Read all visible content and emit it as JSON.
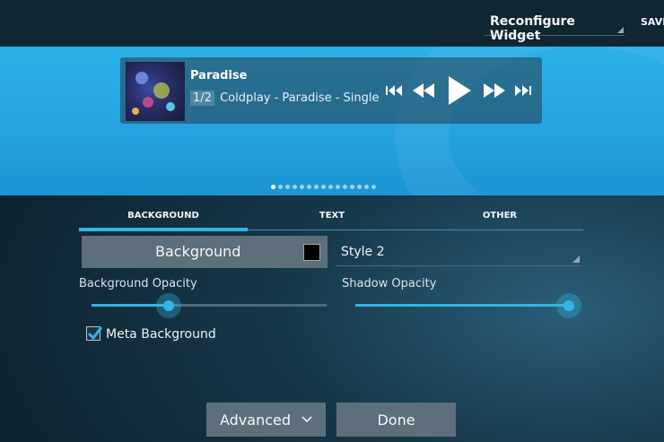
{
  "header": {
    "title": "Reconfigure Widget",
    "save_label": "SAVE"
  },
  "player": {
    "track_title": "Paradise",
    "track_index": "1/2",
    "track_meta": "Coldplay - Paradise - Single",
    "controls": [
      "skip-back-icon",
      "rewind-icon",
      "play-icon",
      "fast-forward-icon",
      "skip-forward-icon"
    ],
    "page_count": 15,
    "current_page": 1
  },
  "tabs": [
    {
      "label": "BACKGROUND",
      "active": true
    },
    {
      "label": "TEXT",
      "active": false
    },
    {
      "label": "OTHER",
      "active": false
    }
  ],
  "background": {
    "button_label": "Background",
    "swatch_color": "#000000",
    "style_value": "Style 2",
    "bg_opacity_label": "Background Opacity",
    "bg_opacity_value": 0.33,
    "shadow_opacity_label": "Shadow Opacity",
    "shadow_opacity_value": 0.99,
    "meta_background_label": "Meta Background",
    "meta_background_checked": true
  },
  "footer": {
    "advanced_label": "Advanced",
    "done_label": "Done"
  },
  "colors": {
    "accent": "#33b5e5",
    "preview_bg": "#23a2de",
    "button_bg": "#5c6f7a"
  }
}
